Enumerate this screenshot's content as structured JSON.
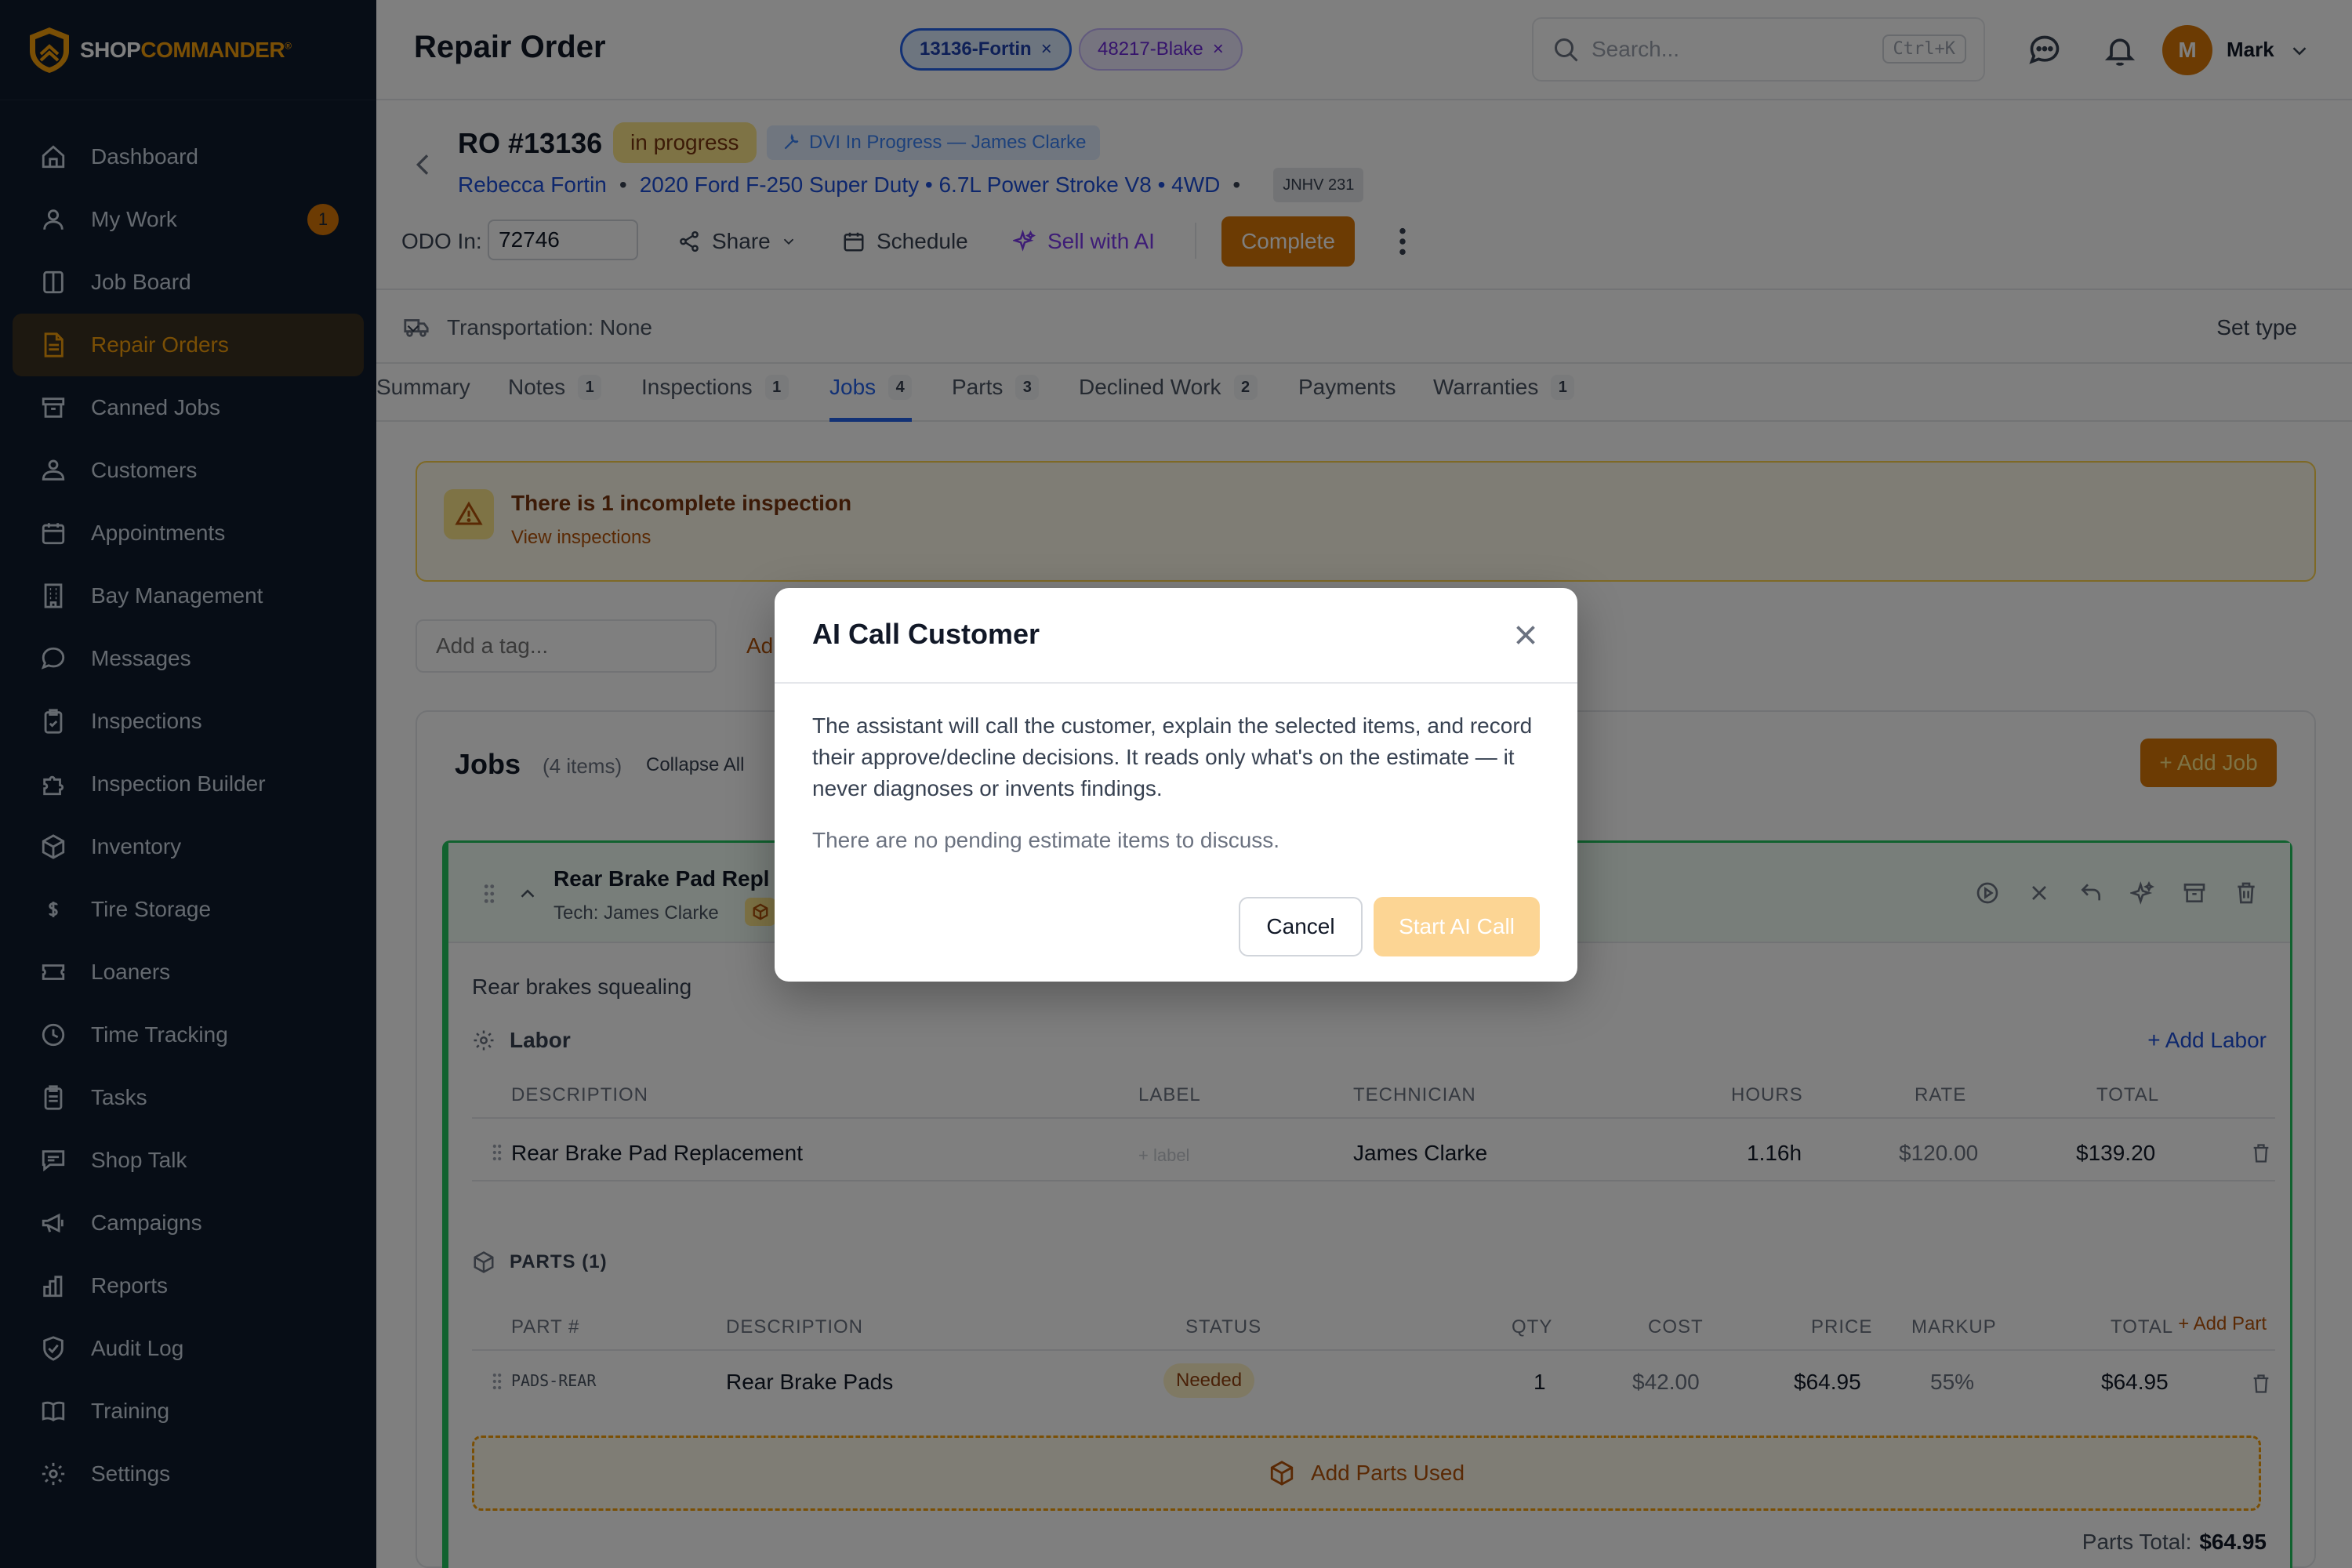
{
  "brand": {
    "name_primary": "SHOP",
    "name_accent": "COMMANDER",
    "mark": "®"
  },
  "sidebar": {
    "items": [
      {
        "label": "Dashboard",
        "icon": "home-icon"
      },
      {
        "label": "My Work",
        "icon": "user-icon",
        "badge": "1"
      },
      {
        "label": "Job Board",
        "icon": "columns-icon"
      },
      {
        "label": "Repair Orders",
        "icon": "document-icon",
        "active": true
      },
      {
        "label": "Canned Jobs",
        "icon": "archive-icon"
      },
      {
        "label": "Customers",
        "icon": "users-icon"
      },
      {
        "label": "Appointments",
        "icon": "calendar-icon"
      },
      {
        "label": "Bay Management",
        "icon": "building-icon"
      },
      {
        "label": "Messages",
        "icon": "chat-icon"
      },
      {
        "label": "Inspections",
        "icon": "clipboard-check-icon"
      },
      {
        "label": "Inspection Builder",
        "icon": "puzzle-icon"
      },
      {
        "label": "Inventory",
        "icon": "box-icon"
      },
      {
        "label": "Tire Storage",
        "icon": "dollar-icon"
      },
      {
        "label": "Loaners",
        "icon": "ticket-icon"
      },
      {
        "label": "Time Tracking",
        "icon": "clock-icon"
      },
      {
        "label": "Tasks",
        "icon": "clipboard-icon"
      },
      {
        "label": "Shop Talk",
        "icon": "message-square-icon"
      },
      {
        "label": "Campaigns",
        "icon": "megaphone-icon"
      },
      {
        "label": "Reports",
        "icon": "bar-chart-icon"
      },
      {
        "label": "Audit Log",
        "icon": "shield-icon"
      },
      {
        "label": "Training",
        "icon": "book-icon"
      },
      {
        "label": "Settings",
        "icon": "gear-icon"
      }
    ]
  },
  "topbar": {
    "title": "Repair Order",
    "chips": [
      {
        "label": "13136-Fortin",
        "close": "×"
      },
      {
        "label": "48217-Blake",
        "close": "×"
      }
    ],
    "search_placeholder": "Search...",
    "search_shortcut": "Ctrl+K",
    "avatar_initial": "M",
    "username": "Mark"
  },
  "ro": {
    "title": "RO #13136",
    "status": "in progress",
    "dvi": "DVI In Progress — James Clarke",
    "customer": "Rebecca Fortin",
    "vehicle": "2020 Ford F-250 Super Duty • 6.7L Power Stroke V8 • 4WD",
    "bullet": "•",
    "plate": "JNHV 231",
    "odo_label": "ODO In:",
    "odo_value": "72746",
    "actions": {
      "share": "Share",
      "schedule": "Schedule",
      "sell_ai": "Sell with AI",
      "complete": "Complete"
    }
  },
  "transport": {
    "label": "Transportation: None",
    "set_type": "Set type"
  },
  "tabs": [
    {
      "label": "Summary"
    },
    {
      "label": "Notes",
      "count": "1"
    },
    {
      "label": "Inspections",
      "count": "1"
    },
    {
      "label": "Jobs",
      "count": "4",
      "active": true
    },
    {
      "label": "Parts",
      "count": "3"
    },
    {
      "label": "Declined Work",
      "count": "2"
    },
    {
      "label": "Payments"
    },
    {
      "label": "Warranties",
      "count": "1"
    }
  ],
  "alert": {
    "title": "There is 1 incomplete inspection",
    "link": "View inspections"
  },
  "tags": {
    "placeholder": "Add a tag...",
    "add": "Ad"
  },
  "jobs": {
    "title": "Jobs",
    "count": "(4 items)",
    "collapse_all": "Collapse All",
    "add_job": "+ Add Job",
    "job": {
      "title": "Rear Brake Pad Repl",
      "tech": "Tech: James Clarke",
      "concern": "Rear brakes squealing",
      "labor": {
        "title": "Labor",
        "add": "+ Add Labor",
        "headers": {
          "description": "DESCRIPTION",
          "label": "LABEL",
          "technician": "TECHNICIAN",
          "hours": "HOURS",
          "rate": "RATE",
          "total": "TOTAL"
        },
        "row": {
          "description": "Rear Brake Pad Replacement",
          "label": "+ label",
          "technician": "James Clarke",
          "hours": "1.16h",
          "rate": "$120.00",
          "total": "$139.20"
        }
      },
      "parts": {
        "title": "PARTS (1)",
        "add": "+ Add Part",
        "headers": {
          "part": "PART #",
          "description": "DESCRIPTION",
          "status": "STATUS",
          "qty": "QTY",
          "cost": "COST",
          "price": "PRICE",
          "markup": "MARKUP",
          "total": "TOTAL"
        },
        "row": {
          "part": "PADS-REAR",
          "description": "Rear Brake Pads",
          "status": "Needed",
          "qty": "1",
          "cost": "$42.00",
          "price": "$64.95",
          "markup": "55%",
          "total": "$64.95"
        },
        "add_used": "Add Parts Used",
        "total_label": "Parts Total:",
        "total_value": "$64.95"
      }
    }
  },
  "modal": {
    "title": "AI Call Customer",
    "body": "The assistant will call the customer, explain the selected items, and record their approve/decline decisions. It reads only what's on the estimate — it never diagnoses or invents findings.",
    "empty": "There are no pending estimate items to discuss.",
    "cancel": "Cancel",
    "start": "Start AI Call"
  },
  "colors": {
    "accent": "#d97706",
    "sidebar_bg": "#0f1b2d",
    "link": "#1d4ed8",
    "success": "#22c55e"
  }
}
